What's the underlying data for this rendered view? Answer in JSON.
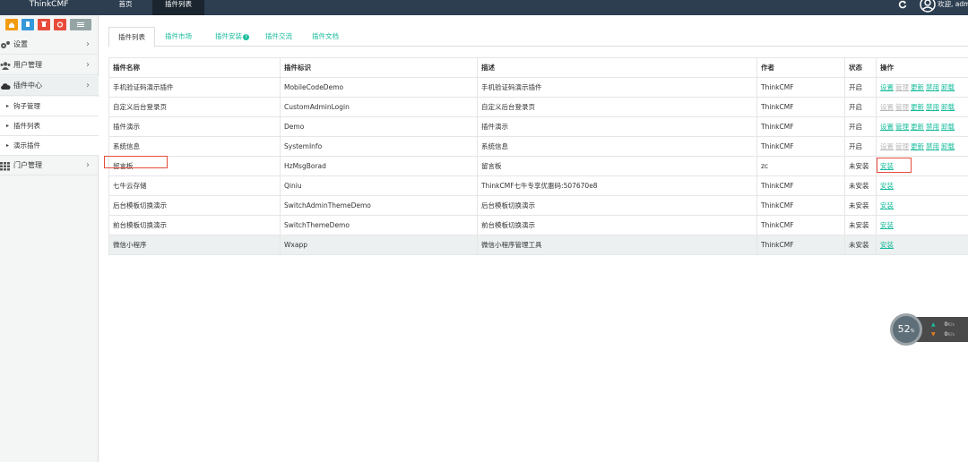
{
  "topbar": {
    "brand": "ThinkCMF",
    "nav": [
      {
        "label": "首页"
      },
      {
        "label": "插件列表"
      }
    ],
    "welcome": "欢迎, adm"
  },
  "sidebar": {
    "shortcut_colors": [
      "#f39c12",
      "#3498db",
      "#e74c3c",
      "#e74c3c",
      "#95a5a6"
    ],
    "menu": [
      {
        "label": "设置",
        "icon": "cogs-icon"
      },
      {
        "label": "用户管理",
        "icon": "users-icon"
      },
      {
        "label": "插件中心",
        "icon": "cloud-icon"
      },
      {
        "label": "门户管理",
        "icon": "th-icon"
      }
    ],
    "sub_items": [
      {
        "label": "钩子管理"
      },
      {
        "label": "插件列表"
      },
      {
        "label": "演示插件"
      }
    ]
  },
  "tabs": [
    {
      "label": "插件列表"
    },
    {
      "label": "插件市场"
    },
    {
      "label": "插件安装"
    },
    {
      "label": "插件交流"
    },
    {
      "label": "插件文档"
    }
  ],
  "table": {
    "headers": [
      "插件名称",
      "插件标识",
      "描述",
      "作者",
      "状态",
      "操作"
    ],
    "rows": [
      {
        "name": "手机验证码演示插件",
        "id": "MobileCodeDemo",
        "desc": "手机验证码演示插件",
        "author": "ThinkCMF",
        "status": "开启"
      },
      {
        "name": "自定义后台登录页",
        "id": "CustomAdminLogin",
        "desc": "自定义后台登录页",
        "author": "ThinkCMF",
        "status": "开启"
      },
      {
        "name": "插件演示",
        "id": "Demo",
        "desc": "插件演示",
        "author": "ThinkCMF",
        "status": "开启"
      },
      {
        "name": "系统信息",
        "id": "SystemInfo",
        "desc": "系统信息",
        "author": "ThinkCMF",
        "status": "开启"
      },
      {
        "name": "留言板",
        "id": "HzMsgBorad",
        "desc": "留言板",
        "author": "zc",
        "status": "未安装"
      },
      {
        "name": "七牛云存储",
        "id": "Qiniu",
        "desc": "ThinkCMF七牛专享优惠码:507670e8",
        "author": "ThinkCMF",
        "status": "未安装"
      },
      {
        "name": "后台模板切换演示",
        "id": "SwitchAdminThemeDemo",
        "desc": "后台模板切换演示",
        "author": "ThinkCMF",
        "status": "未安装"
      },
      {
        "name": "前台模板切换演示",
        "id": "SwitchThemeDemo",
        "desc": "前台模板切换演示",
        "author": "ThinkCMF",
        "status": "未安装"
      },
      {
        "name": "微信小程序",
        "id": "Wxapp",
        "desc": "微信小程序管理工具",
        "author": "ThinkCMF",
        "status": "未安装"
      }
    ],
    "actions": {
      "settings": "设置",
      "manage": "管理",
      "update": "更新",
      "disable": "禁用",
      "uninstall": "卸载",
      "install": "安装"
    }
  },
  "speed_widget": {
    "percent": "52",
    "percent_unit": "%",
    "up": "0",
    "down": "0",
    "unit": "K/s"
  },
  "colors": {
    "topbar": "#2c3e50",
    "accent": "#18bc9c",
    "marker": "#e74c3c"
  }
}
